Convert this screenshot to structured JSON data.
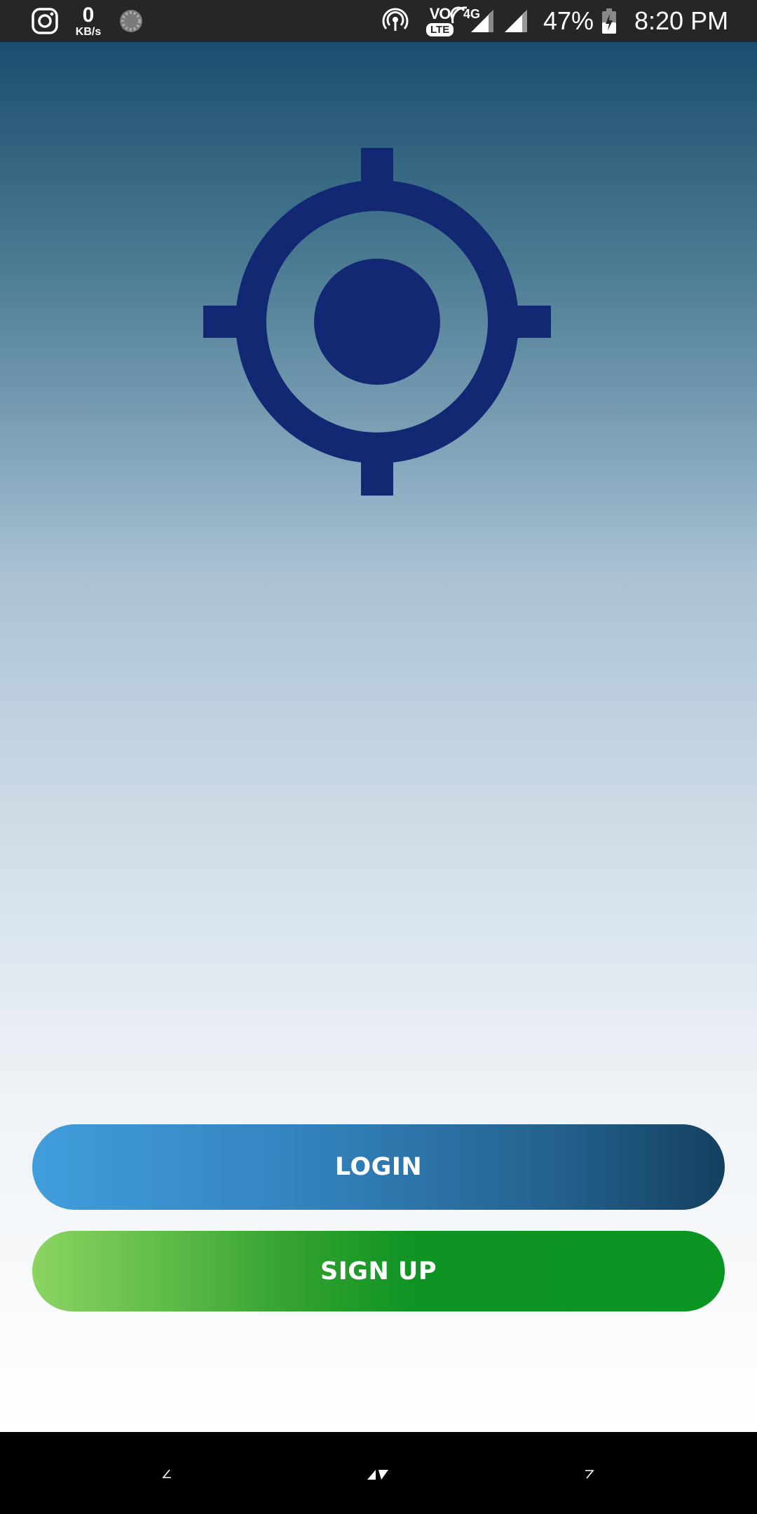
{
  "status_bar": {
    "net_speed_value": "0",
    "net_speed_unit": "KB/s",
    "network_type": "4G",
    "volte_label_top": "VO",
    "volte_label_bottom": "LTE",
    "battery_percent": "47%",
    "time": "8:20 PM",
    "icons": [
      "instagram-icon",
      "loading-circle-icon",
      "hotspot-icon",
      "volte-icon",
      "signal-icon",
      "signal-icon",
      "battery-charging-icon"
    ]
  },
  "logo": {
    "icon": "crosshair-location-icon",
    "color": "#132873"
  },
  "buttons": {
    "login_label": "LOGIN",
    "signup_label": "SIGN UP"
  },
  "nav_bar": {
    "icons": [
      "back-icon",
      "home-icon",
      "recents-icon"
    ]
  }
}
